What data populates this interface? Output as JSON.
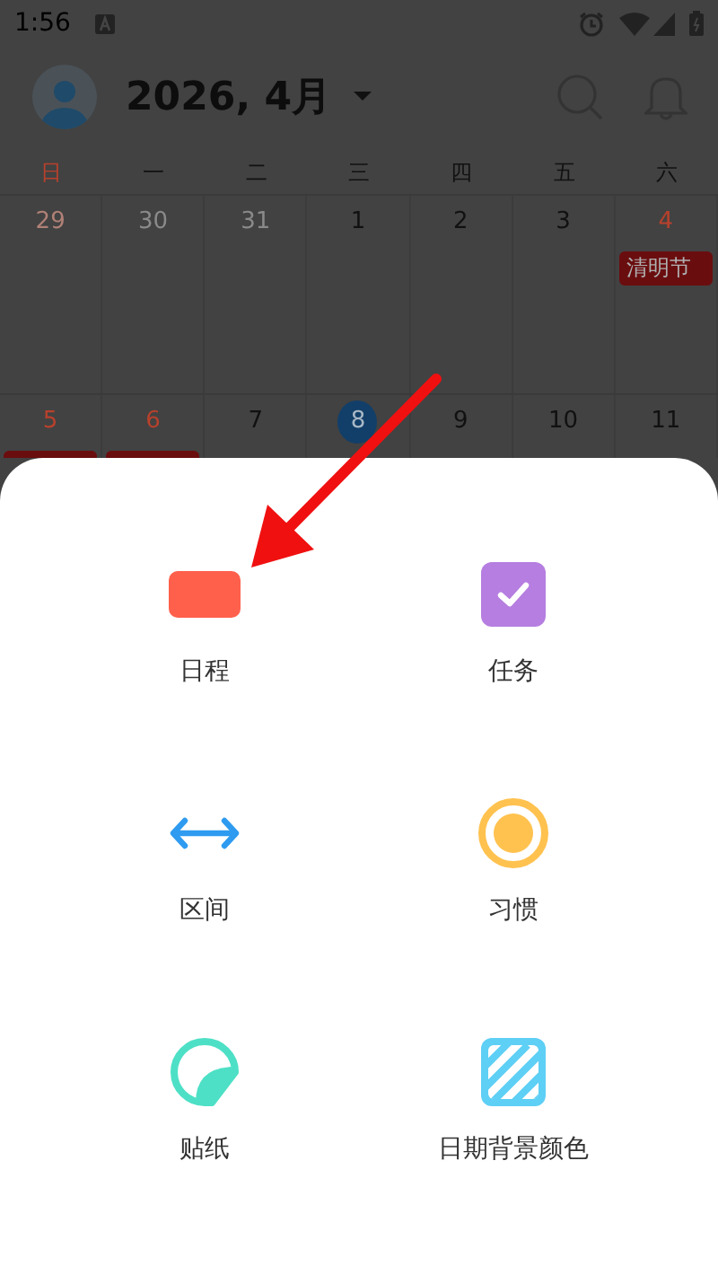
{
  "status_bar": {
    "time": "1:56"
  },
  "header": {
    "title": "2026, 4月"
  },
  "weekdays": [
    {
      "label": "日",
      "red": true
    },
    {
      "label": "一",
      "red": false
    },
    {
      "label": "二",
      "red": false
    },
    {
      "label": "三",
      "red": false
    },
    {
      "label": "四",
      "red": false
    },
    {
      "label": "五",
      "red": false
    },
    {
      "label": "六",
      "red": false
    }
  ],
  "weeks": [
    [
      {
        "day": "29",
        "muted": true,
        "red": true,
        "today": false
      },
      {
        "day": "30",
        "muted": true,
        "red": false,
        "today": false
      },
      {
        "day": "31",
        "muted": true,
        "red": false,
        "today": false
      },
      {
        "day": "1",
        "muted": false,
        "red": false,
        "today": false
      },
      {
        "day": "2",
        "muted": false,
        "red": false,
        "today": false
      },
      {
        "day": "3",
        "muted": false,
        "red": false,
        "today": false
      },
      {
        "day": "4",
        "muted": false,
        "red": true,
        "today": false,
        "events": [
          {
            "kind": "tag",
            "label": "清明节"
          }
        ]
      }
    ],
    [
      {
        "day": "5",
        "muted": false,
        "red": true,
        "today": false,
        "events": [
          {
            "kind": "cut"
          }
        ]
      },
      {
        "day": "6",
        "muted": false,
        "red": true,
        "today": false,
        "events": [
          {
            "kind": "cut"
          }
        ]
      },
      {
        "day": "7",
        "muted": false,
        "red": false,
        "today": false
      },
      {
        "day": "8",
        "muted": false,
        "red": false,
        "today": true
      },
      {
        "day": "9",
        "muted": false,
        "red": false,
        "today": false
      },
      {
        "day": "10",
        "muted": false,
        "red": false,
        "today": false
      },
      {
        "day": "11",
        "muted": false,
        "red": false,
        "today": false
      }
    ]
  ],
  "sheet": {
    "items": [
      {
        "kind": "schedule",
        "label": "日程"
      },
      {
        "kind": "task",
        "label": "任务"
      },
      {
        "kind": "range",
        "label": "区间"
      },
      {
        "kind": "habit",
        "label": "习惯"
      },
      {
        "kind": "sticker",
        "label": "贴纸"
      },
      {
        "kind": "background",
        "label": "日期背景颜色"
      }
    ]
  }
}
